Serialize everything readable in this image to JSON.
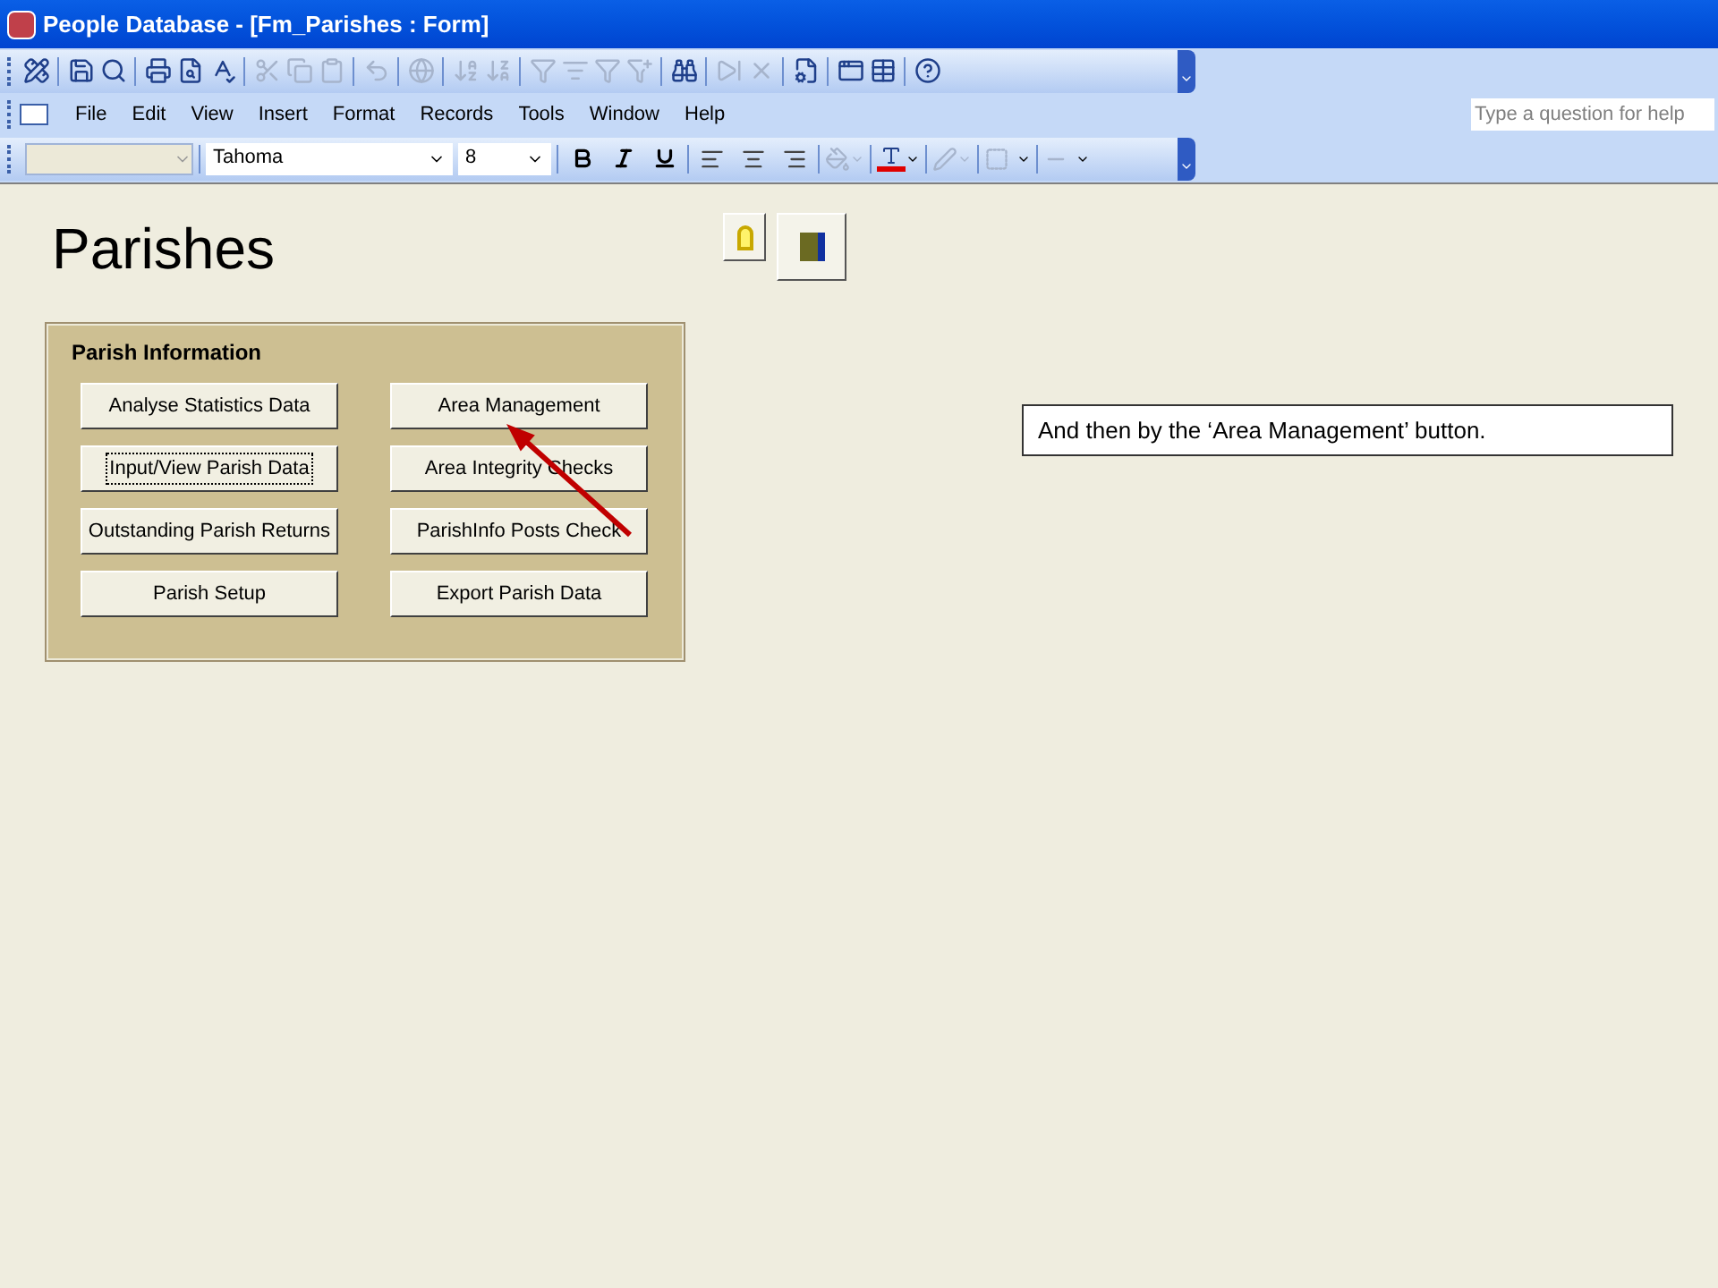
{
  "window": {
    "title": "People Database - [Fm_Parishes : Form]"
  },
  "standard_toolbar": [
    {
      "kind": "design",
      "disabled": false
    },
    {
      "kind": "sep"
    },
    {
      "kind": "save",
      "disabled": false
    },
    {
      "kind": "search",
      "disabled": false
    },
    {
      "kind": "sep"
    },
    {
      "kind": "print",
      "disabled": false
    },
    {
      "kind": "preview",
      "disabled": false
    },
    {
      "kind": "spell",
      "disabled": false
    },
    {
      "kind": "sep"
    },
    {
      "kind": "cut",
      "disabled": true
    },
    {
      "kind": "copy",
      "disabled": true
    },
    {
      "kind": "paste",
      "disabled": true
    },
    {
      "kind": "sep"
    },
    {
      "kind": "undo",
      "disabled": true
    },
    {
      "kind": "sep"
    },
    {
      "kind": "link",
      "disabled": true
    },
    {
      "kind": "sep"
    },
    {
      "kind": "sortasc",
      "disabled": true
    },
    {
      "kind": "sortdesc",
      "disabled": true
    },
    {
      "kind": "sep"
    },
    {
      "kind": "filtersel",
      "disabled": true
    },
    {
      "kind": "filterform",
      "disabled": true
    },
    {
      "kind": "filter",
      "disabled": true
    },
    {
      "kind": "filteradv",
      "disabled": true
    },
    {
      "kind": "sep"
    },
    {
      "kind": "find",
      "disabled": false
    },
    {
      "kind": "sep"
    },
    {
      "kind": "newrec",
      "disabled": true
    },
    {
      "kind": "delrec",
      "disabled": true
    },
    {
      "kind": "sep"
    },
    {
      "kind": "props",
      "disabled": false
    },
    {
      "kind": "sep"
    },
    {
      "kind": "dbwin",
      "disabled": false
    },
    {
      "kind": "newobj",
      "disabled": false
    },
    {
      "kind": "sep"
    },
    {
      "kind": "help",
      "disabled": false
    }
  ],
  "menu": [
    "File",
    "Edit",
    "View",
    "Insert",
    "Format",
    "Records",
    "Tools",
    "Window",
    "Help"
  ],
  "help_search": {
    "placeholder": "Type a question for help"
  },
  "formatting_toolbar": {
    "font": "Tahoma",
    "size": "8"
  },
  "form": {
    "title": "Parishes",
    "panel": {
      "title": "Parish Information",
      "buttons": [
        {
          "label": "Analyse Statistics Data",
          "focused": false
        },
        {
          "label": "Area Management",
          "focused": false
        },
        {
          "label": "Input/View Parish Data",
          "focused": true
        },
        {
          "label": "Area Integrity Checks",
          "focused": false
        },
        {
          "label": "Outstanding Parish Returns",
          "focused": false
        },
        {
          "label": "ParishInfo Posts Check",
          "focused": false
        },
        {
          "label": "Parish Setup",
          "focused": false
        },
        {
          "label": "Export Parish Data",
          "focused": false
        }
      ]
    }
  },
  "callout": "And then by the ‘Area Management’ button."
}
